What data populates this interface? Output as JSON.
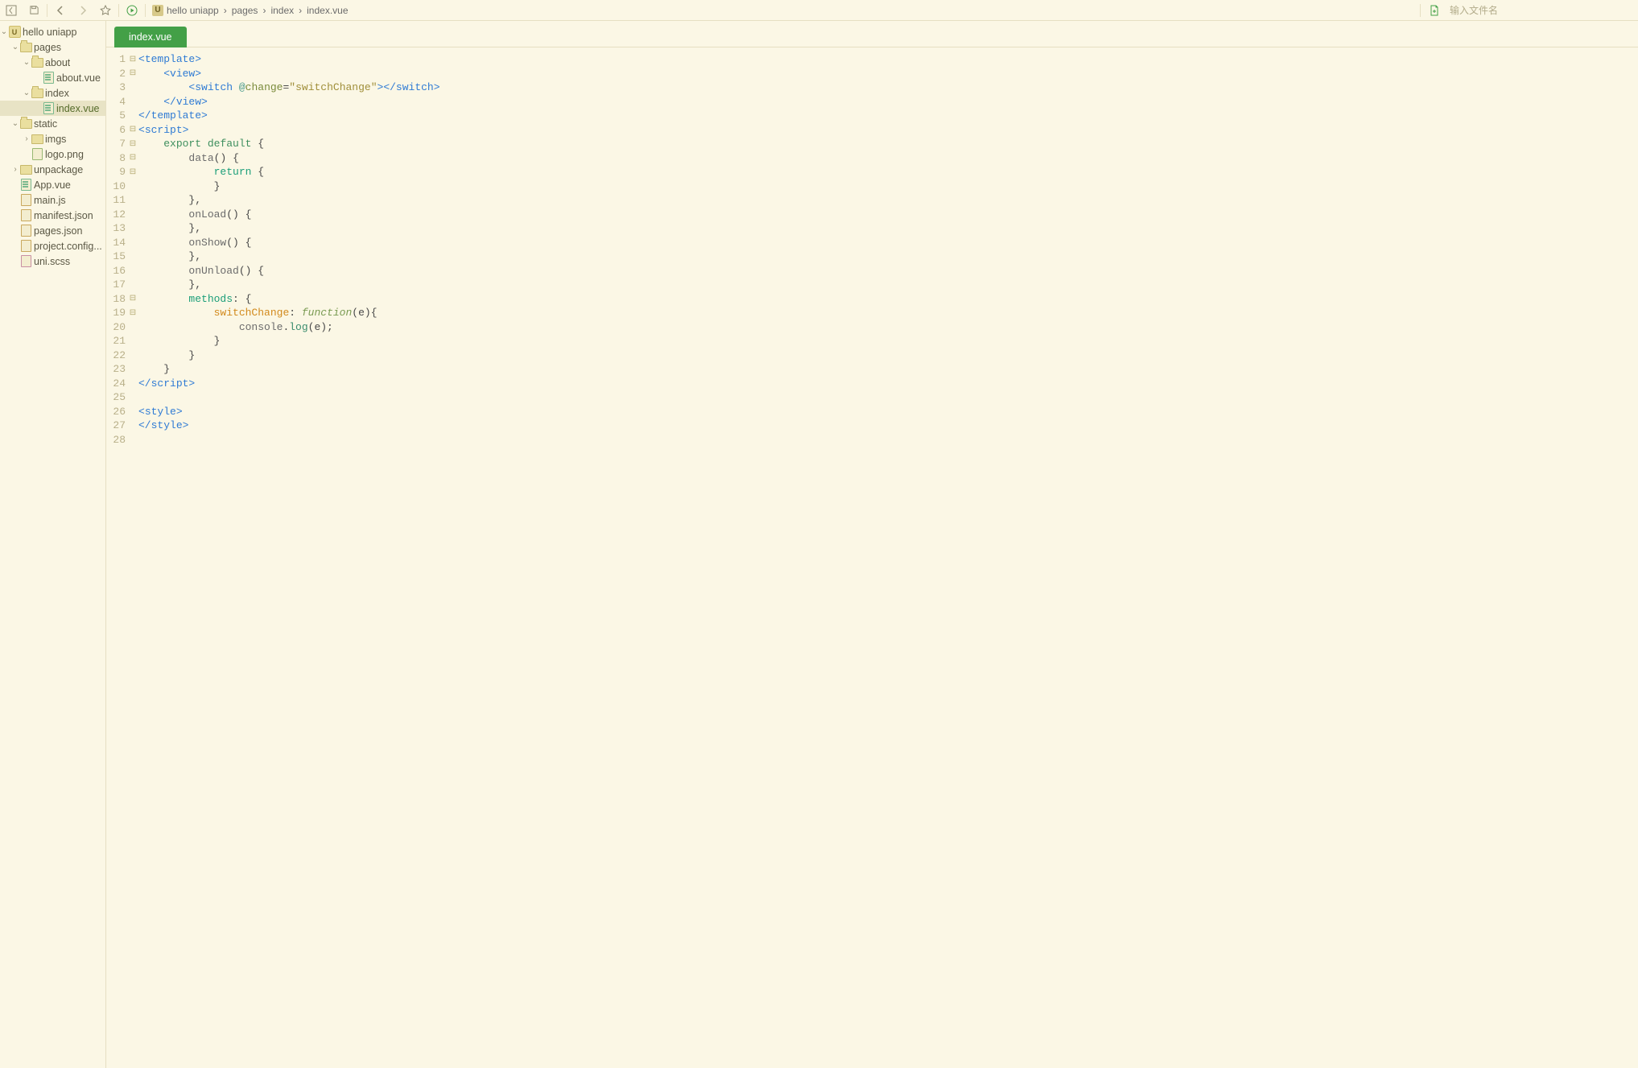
{
  "toolbar": {
    "search_placeholder": "输入文件名"
  },
  "breadcrumbs": [
    "hello uniapp",
    "pages",
    "index",
    "index.vue"
  ],
  "project_badge": "U",
  "tree": [
    {
      "depth": 0,
      "type": "project",
      "label": "hello uniapp",
      "expanded": true
    },
    {
      "depth": 1,
      "type": "folder",
      "label": "pages",
      "expanded": true
    },
    {
      "depth": 2,
      "type": "folder",
      "label": "about",
      "expanded": true
    },
    {
      "depth": 3,
      "type": "file",
      "kind": "vue",
      "label": "about.vue"
    },
    {
      "depth": 2,
      "type": "folder",
      "label": "index",
      "expanded": true
    },
    {
      "depth": 3,
      "type": "file",
      "kind": "vue",
      "label": "index.vue",
      "active": true
    },
    {
      "depth": 1,
      "type": "folder",
      "label": "static",
      "expanded": true
    },
    {
      "depth": 2,
      "type": "folder",
      "label": "imgs",
      "expanded": false
    },
    {
      "depth": 2,
      "type": "file",
      "kind": "img",
      "label": "logo.png"
    },
    {
      "depth": 1,
      "type": "folder",
      "label": "unpackage",
      "expanded": false
    },
    {
      "depth": 1,
      "type": "file",
      "kind": "vue",
      "label": "App.vue"
    },
    {
      "depth": 1,
      "type": "file",
      "kind": "js",
      "label": "main.js"
    },
    {
      "depth": 1,
      "type": "file",
      "kind": "json",
      "label": "manifest.json"
    },
    {
      "depth": 1,
      "type": "file",
      "kind": "json",
      "label": "pages.json"
    },
    {
      "depth": 1,
      "type": "file",
      "kind": "json",
      "label": "project.config..."
    },
    {
      "depth": 1,
      "type": "file",
      "kind": "scss",
      "label": "uni.scss"
    }
  ],
  "tabs": [
    {
      "label": "index.vue",
      "active": true
    }
  ],
  "code": {
    "line_count": 28,
    "fold_markers": {
      "1": "⊟",
      "2": "⊟",
      "6": "⊟",
      "7": "⊟",
      "8": "⊟",
      "9": "⊟",
      "18": "⊟",
      "19": "⊟"
    },
    "lines": [
      [
        [
          "t-pun",
          "<"
        ],
        [
          "t-tag",
          "template"
        ],
        [
          "t-pun",
          ">"
        ]
      ],
      [
        [
          "t-plain",
          "    "
        ],
        [
          "t-pun",
          "<"
        ],
        [
          "t-tag",
          "view"
        ],
        [
          "t-pun",
          ">"
        ]
      ],
      [
        [
          "t-plain",
          "        "
        ],
        [
          "t-pun",
          "<"
        ],
        [
          "t-tag",
          "switch"
        ],
        [
          "t-plain",
          " "
        ],
        [
          "t-at",
          "@"
        ],
        [
          "t-attr",
          "change"
        ],
        [
          "t-plain",
          "="
        ],
        [
          "t-str",
          "\"switchChange\""
        ],
        [
          "t-pun",
          "></"
        ],
        [
          "t-tag",
          "switch"
        ],
        [
          "t-pun",
          ">"
        ]
      ],
      [
        [
          "t-plain",
          "    "
        ],
        [
          "t-pun",
          "</"
        ],
        [
          "t-tag",
          "view"
        ],
        [
          "t-pun",
          ">"
        ]
      ],
      [
        [
          "t-pun",
          "</"
        ],
        [
          "t-tag",
          "template"
        ],
        [
          "t-pun",
          ">"
        ]
      ],
      [
        [
          "t-pun",
          "<"
        ],
        [
          "t-tag",
          "script"
        ],
        [
          "t-pun",
          ">"
        ]
      ],
      [
        [
          "t-plain",
          "    "
        ],
        [
          "t-kw",
          "export"
        ],
        [
          "t-plain",
          " "
        ],
        [
          "t-kw",
          "default"
        ],
        [
          "t-plain",
          " "
        ],
        [
          "t-br",
          "{"
        ]
      ],
      [
        [
          "t-plain",
          "        "
        ],
        [
          "t-id",
          "data"
        ],
        [
          "t-plain",
          "()"
        ],
        [
          "t-plain",
          " "
        ],
        [
          "t-br",
          "{"
        ]
      ],
      [
        [
          "t-plain",
          "            "
        ],
        [
          "t-kw2",
          "return"
        ],
        [
          "t-plain",
          " "
        ],
        [
          "t-br",
          "{"
        ]
      ],
      [
        [
          "t-plain",
          "            "
        ],
        [
          "t-br",
          "}"
        ]
      ],
      [
        [
          "t-plain",
          "        "
        ],
        [
          "t-br",
          "}"
        ],
        [
          "t-plain",
          ","
        ]
      ],
      [
        [
          "t-plain",
          "        "
        ],
        [
          "t-id",
          "onLoad"
        ],
        [
          "t-plain",
          "()"
        ],
        [
          "t-plain",
          " "
        ],
        [
          "t-br",
          "{"
        ]
      ],
      [
        [
          "t-plain",
          "        "
        ],
        [
          "t-br",
          "}"
        ],
        [
          "t-plain",
          ","
        ]
      ],
      [
        [
          "t-plain",
          "        "
        ],
        [
          "t-id",
          "onShow"
        ],
        [
          "t-plain",
          "()"
        ],
        [
          "t-plain",
          " "
        ],
        [
          "t-br",
          "{"
        ]
      ],
      [
        [
          "t-plain",
          "        "
        ],
        [
          "t-br",
          "}"
        ],
        [
          "t-plain",
          ","
        ]
      ],
      [
        [
          "t-plain",
          "        "
        ],
        [
          "t-id",
          "onUnload"
        ],
        [
          "t-plain",
          "()"
        ],
        [
          "t-plain",
          " "
        ],
        [
          "t-br",
          "{"
        ]
      ],
      [
        [
          "t-plain",
          "        "
        ],
        [
          "t-br",
          "}"
        ],
        [
          "t-plain",
          ","
        ]
      ],
      [
        [
          "t-plain",
          "        "
        ],
        [
          "t-kw2",
          "methods"
        ],
        [
          "t-plain",
          ": "
        ],
        [
          "t-br",
          "{"
        ]
      ],
      [
        [
          "t-plain",
          "            "
        ],
        [
          "t-name",
          "switchChange"
        ],
        [
          "t-plain",
          ": "
        ],
        [
          "t-fn",
          "function"
        ],
        [
          "t-plain",
          "(e)"
        ],
        [
          "t-br",
          "{"
        ]
      ],
      [
        [
          "t-plain",
          "                "
        ],
        [
          "t-id",
          "console"
        ],
        [
          "t-plain",
          "."
        ],
        [
          "t-call",
          "log"
        ],
        [
          "t-plain",
          "(e);"
        ]
      ],
      [
        [
          "t-plain",
          "            "
        ],
        [
          "t-br",
          "}"
        ]
      ],
      [
        [
          "t-plain",
          "        "
        ],
        [
          "t-br",
          "}"
        ]
      ],
      [
        [
          "t-plain",
          "    "
        ],
        [
          "t-br",
          "}"
        ]
      ],
      [
        [
          "t-pun",
          "</"
        ],
        [
          "t-tag",
          "script"
        ],
        [
          "t-pun",
          ">"
        ]
      ],
      [],
      [
        [
          "t-pun",
          "<"
        ],
        [
          "t-tag",
          "style"
        ],
        [
          "t-pun",
          ">"
        ]
      ],
      [
        [
          "t-pun",
          "</"
        ],
        [
          "t-tag",
          "style"
        ],
        [
          "t-pun",
          ">"
        ]
      ],
      []
    ]
  }
}
